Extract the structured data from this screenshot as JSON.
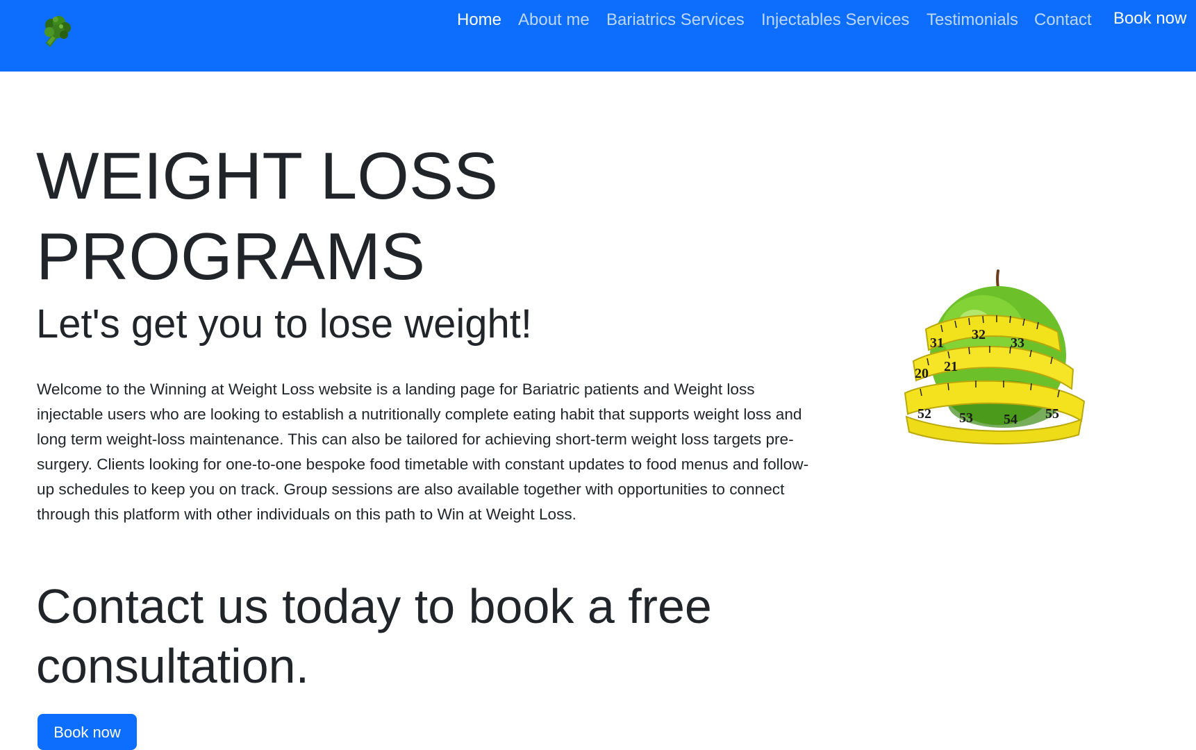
{
  "navbar": {
    "background": "#0d6efd",
    "logo_icon": "broccoli-icon",
    "links": [
      {
        "label": "Home",
        "active": true
      },
      {
        "label": "About me",
        "active": false
      },
      {
        "label": "Bariatrics Services",
        "active": false
      },
      {
        "label": "Injectables Services",
        "active": false
      },
      {
        "label": "Testimonials",
        "active": false
      },
      {
        "label": "Contact",
        "active": false
      }
    ],
    "book_label": "Book now"
  },
  "hero": {
    "title_line1": "WEIGHT LOSS",
    "title_line2": "PROGRAMS",
    "subtitle": "Let's get you to lose weight!",
    "body": "Welcome to the Winning at Weight Loss website is a landing page for Bariatric patients and Weight loss injectable users who are looking to establish a nutritionally complete eating habit that supports weight loss and long term weight-loss maintenance. This can also be tailored for achieving short-term weight loss targets pre-surgery. Clients looking for one-to-one bespoke food timetable with constant updates to food menus and follow-up schedules to keep you on track. Group sessions are also available together with opportunities to connect through this platform with other individuals on this path to Win at Weight Loss.",
    "cta_heading": "Contact us today to book a free consultation.",
    "cta_button": "Book now",
    "image_icon": "apple-measuring-tape-icon",
    "tape_numbers": [
      "31",
      "32",
      "33",
      "20",
      "21",
      "52",
      "53",
      "54",
      "55"
    ]
  }
}
